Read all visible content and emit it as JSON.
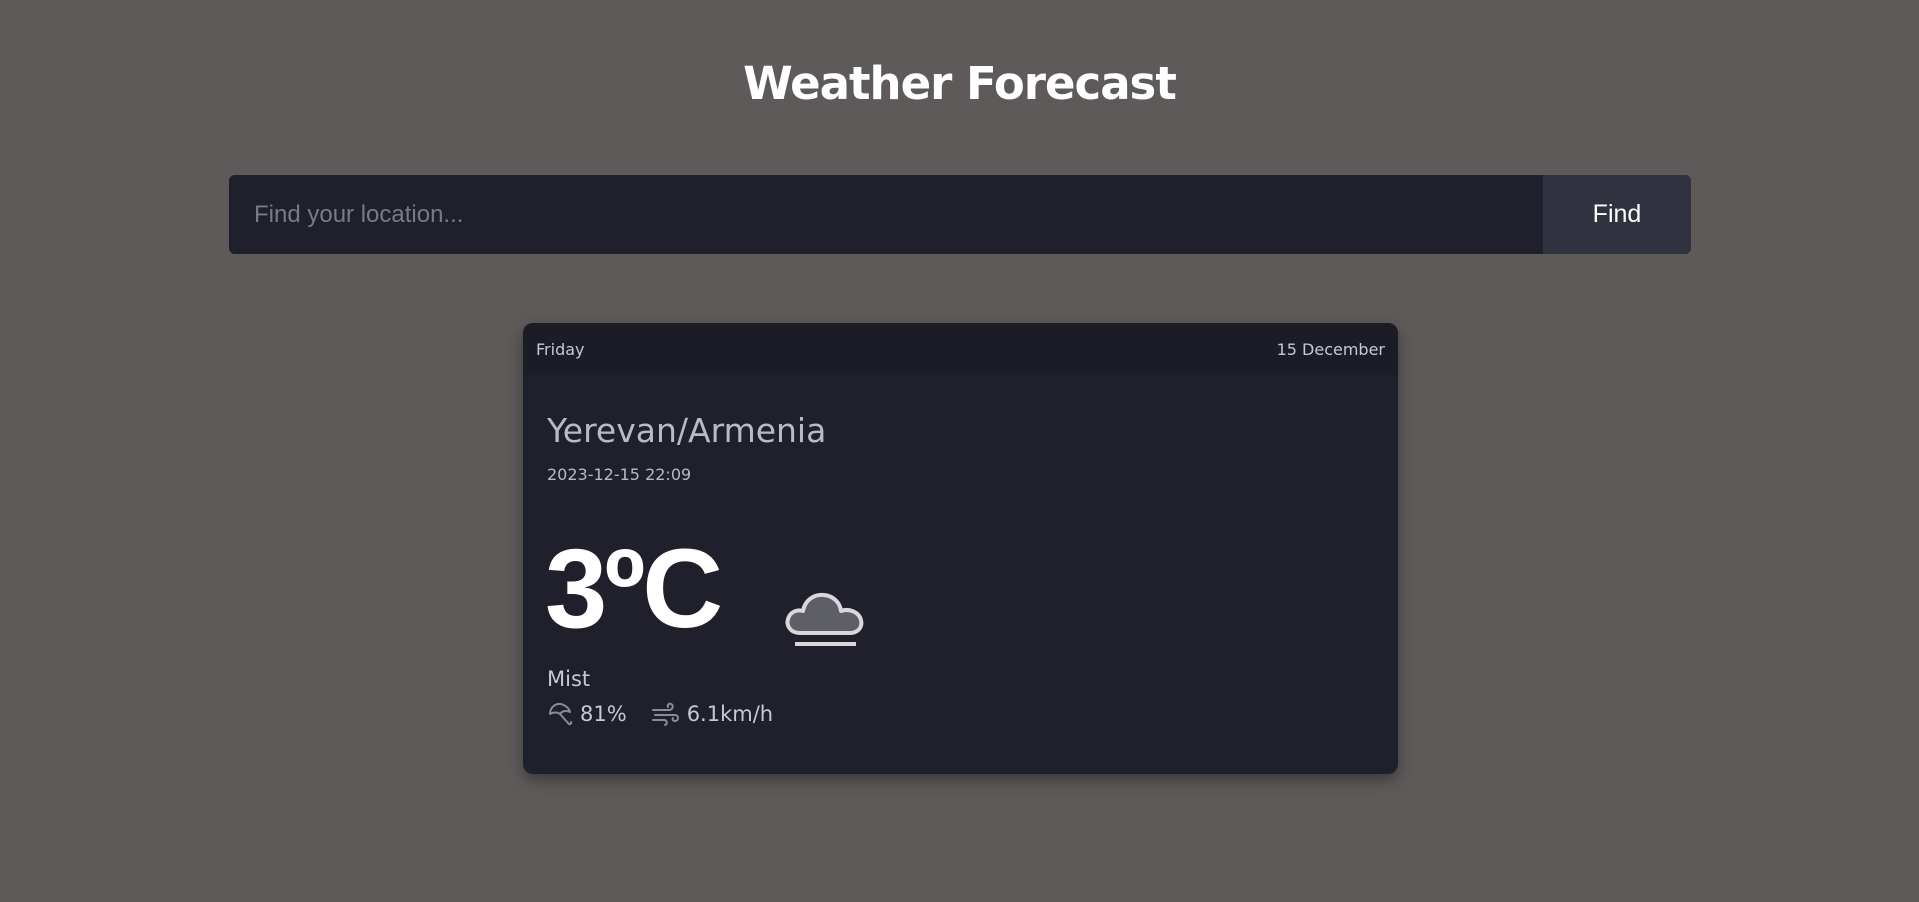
{
  "header": {
    "title": "Weather Forecast"
  },
  "search": {
    "placeholder": "Find your location...",
    "value": "",
    "button_label": "Find"
  },
  "card": {
    "day": "Friday",
    "date": "15 December",
    "location": "Yerevan/Armenia",
    "datetime": "2023-12-15 22:09",
    "temperature": "3ºC",
    "condition": "Mist",
    "condition_icon": "mist-cloud-icon",
    "humidity": "81%",
    "humidity_icon": "umbrella-icon",
    "wind": "6.1km/h",
    "wind_icon": "wind-icon"
  },
  "colors": {
    "page_background": "#5d5a59",
    "card_background": "#1f202b",
    "card_header_background": "#1b1c25",
    "button_background": "#30323f",
    "text_primary": "#ffffff",
    "text_muted": "#c8c9d0"
  }
}
